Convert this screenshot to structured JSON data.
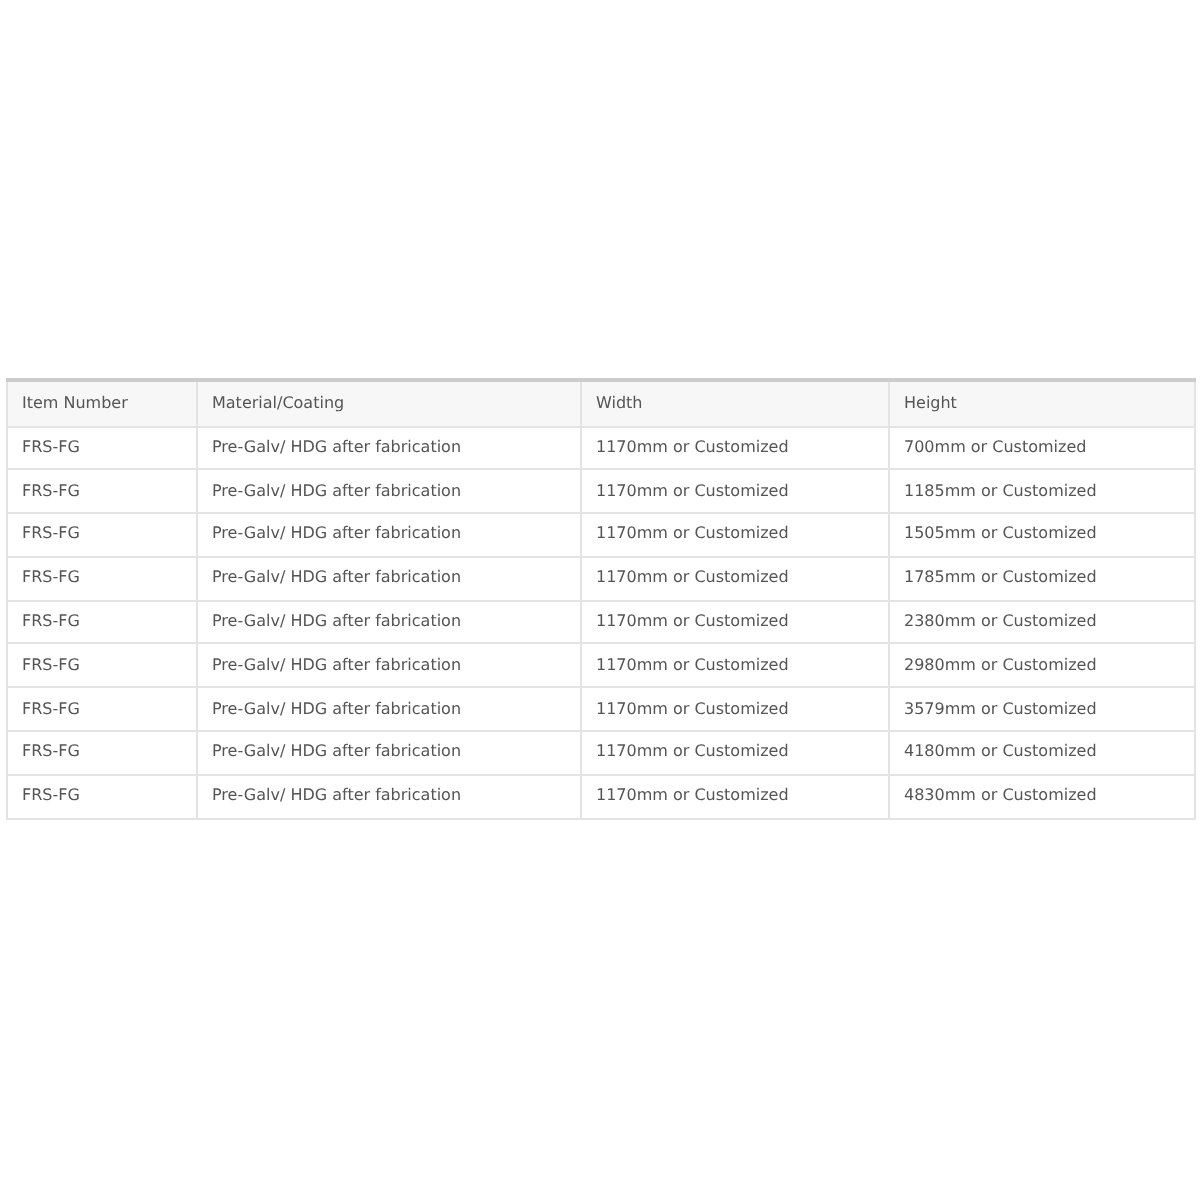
{
  "table": {
    "columns": [
      "Item Number",
      "Material/Coating",
      "Width",
      "Height"
    ],
    "rows": [
      [
        "FRS-FG",
        "Pre-Galv/ HDG after fabrication",
        "1170mm or Customized",
        "700mm or Customized"
      ],
      [
        "FRS-FG",
        "Pre-Galv/ HDG after fabrication",
        "1170mm or Customized",
        "1185mm or Customized"
      ],
      [
        "FRS-FG",
        "Pre-Galv/ HDG after fabrication",
        "1170mm or Customized",
        "1505mm or Customized"
      ],
      [
        "FRS-FG",
        "Pre-Galv/ HDG after fabrication",
        "1170mm or Customized",
        "1785mm or Customized"
      ],
      [
        "FRS-FG",
        "Pre-Galv/ HDG after fabrication",
        "1170mm or Customized",
        "2380mm or Customized"
      ],
      [
        "FRS-FG",
        "Pre-Galv/ HDG after fabrication",
        "1170mm or Customized",
        "2980mm or Customized"
      ],
      [
        "FRS-FG",
        "Pre-Galv/ HDG after fabrication",
        "1170mm or Customized",
        "3579mm or Customized"
      ],
      [
        "FRS-FG",
        "Pre-Galv/ HDG after fabrication",
        "1170mm or Customized",
        "4180mm or Customized"
      ],
      [
        "FRS-FG",
        "Pre-Galv/ HDG after fabrication",
        "1170mm or Customized",
        "4830mm or Customized"
      ]
    ]
  }
}
